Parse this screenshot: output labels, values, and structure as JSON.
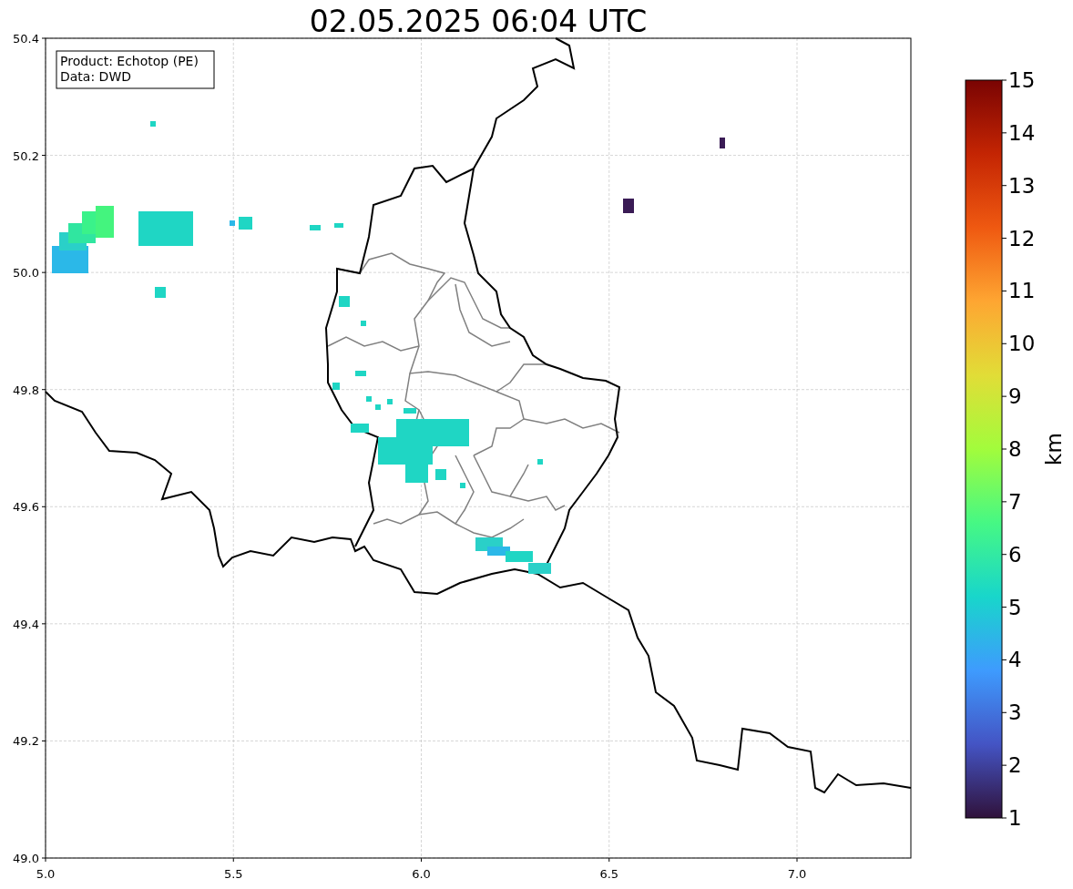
{
  "title": "02.05.2025 06:04 UTC",
  "info_box": {
    "lines": [
      "Product: Echotop (PE)",
      "Data: DWD"
    ]
  },
  "map": {
    "x_ticks": [
      "5.0",
      "5.5",
      "6.0",
      "6.5",
      "7.0"
    ],
    "y_ticks": [
      "50.4",
      "50.2",
      "50.0",
      "49.8",
      "49.6",
      "49.4",
      "49.2",
      "49.0"
    ]
  },
  "colorbar": {
    "label": "km",
    "ticks": [
      "15",
      "14",
      "13",
      "12",
      "11",
      "10",
      "9",
      "8",
      "7",
      "6",
      "5",
      "4",
      "3",
      "2",
      "1"
    ]
  }
}
